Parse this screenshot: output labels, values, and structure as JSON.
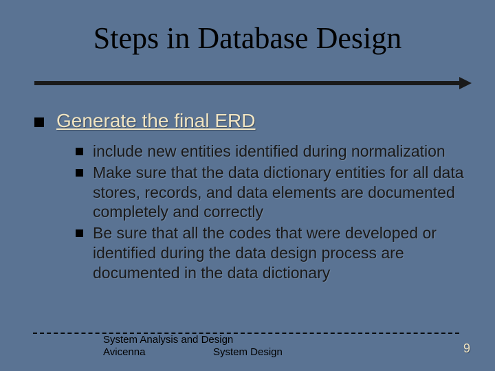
{
  "slide": {
    "title": "Steps in Database Design",
    "heading": "Generate the final ERD",
    "bullets": [
      "include new entities identified during normalization",
      "Make sure that the data dictionary entities for all data stores, records, and data elements are documented completely and correctly",
      "Be sure that all the codes that were developed or identified during the data design process are documented in the data dictionary"
    ],
    "footer": {
      "line1": "System Analysis and Design",
      "left": "Avicenna",
      "center": "System Design",
      "page": "9"
    }
  }
}
